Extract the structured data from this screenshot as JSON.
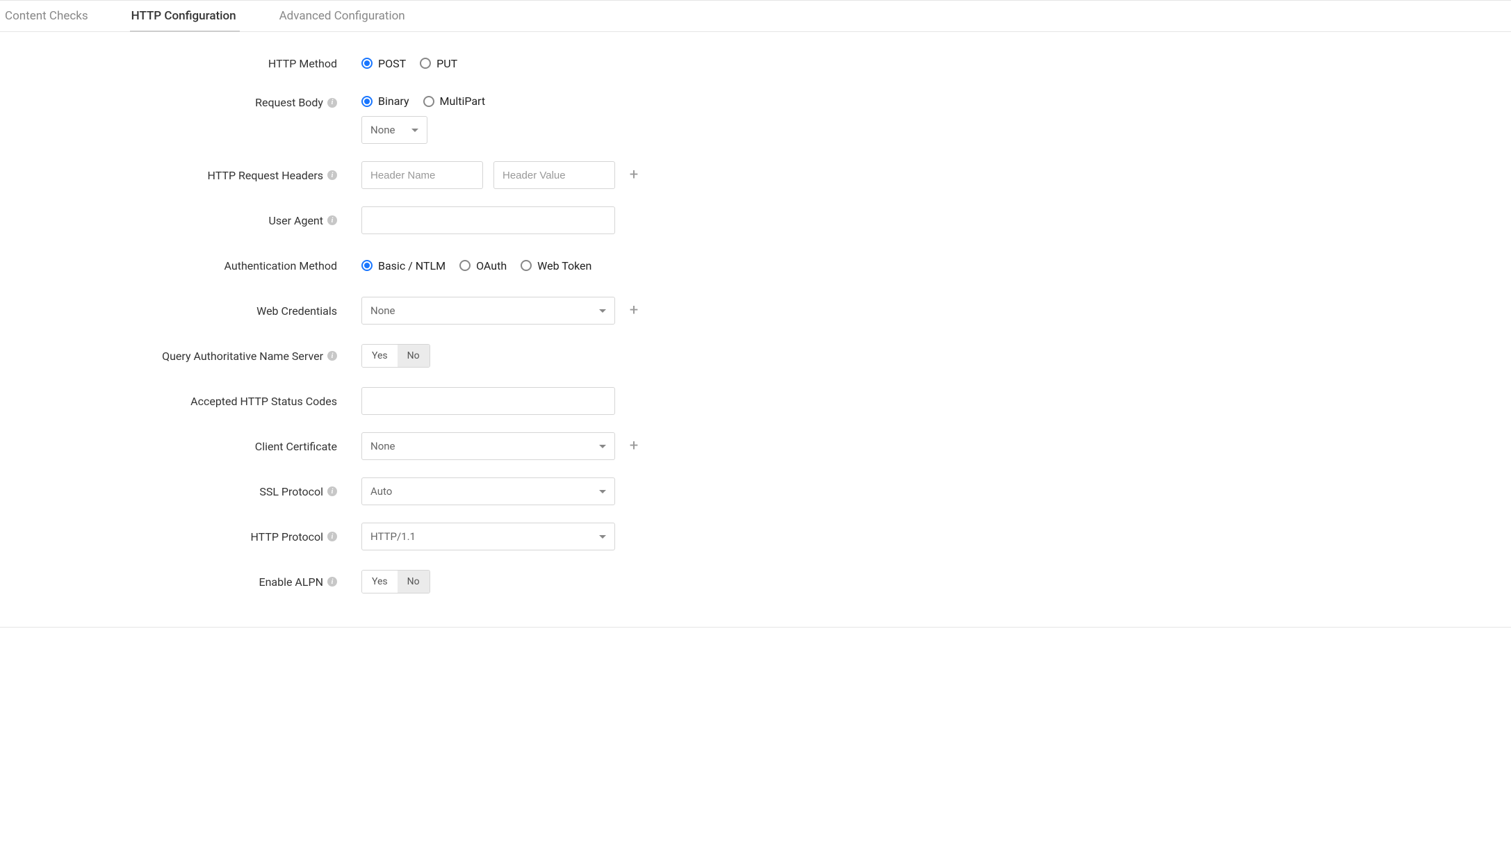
{
  "tabs": {
    "content_checks": "Content Checks",
    "http_config": "HTTP Configuration",
    "advanced_config": "Advanced Configuration"
  },
  "labels": {
    "http_method": "HTTP Method",
    "request_body": "Request Body",
    "http_request_headers": "HTTP Request Headers",
    "user_agent": "User Agent",
    "auth_method": "Authentication Method",
    "web_credentials": "Web Credentials",
    "query_auth_ns": "Query Authoritative Name Server",
    "accepted_status": "Accepted HTTP Status Codes",
    "client_cert": "Client Certificate",
    "ssl_protocol": "SSL Protocol",
    "http_protocol": "HTTP Protocol",
    "enable_alpn": "Enable ALPN"
  },
  "options": {
    "http_method": {
      "post": "POST",
      "put": "PUT"
    },
    "request_body": {
      "binary": "Binary",
      "multipart": "MultiPart"
    },
    "auth_method": {
      "basic": "Basic / NTLM",
      "oauth": "OAuth",
      "webtoken": "Web Token"
    },
    "toggle": {
      "yes": "Yes",
      "no": "No"
    }
  },
  "values": {
    "body_select": "None",
    "web_credentials": "None",
    "client_cert": "None",
    "ssl_protocol": "Auto",
    "http_protocol": "HTTP/1.1"
  },
  "placeholders": {
    "header_name": "Header Name",
    "header_value": "Header Value"
  }
}
